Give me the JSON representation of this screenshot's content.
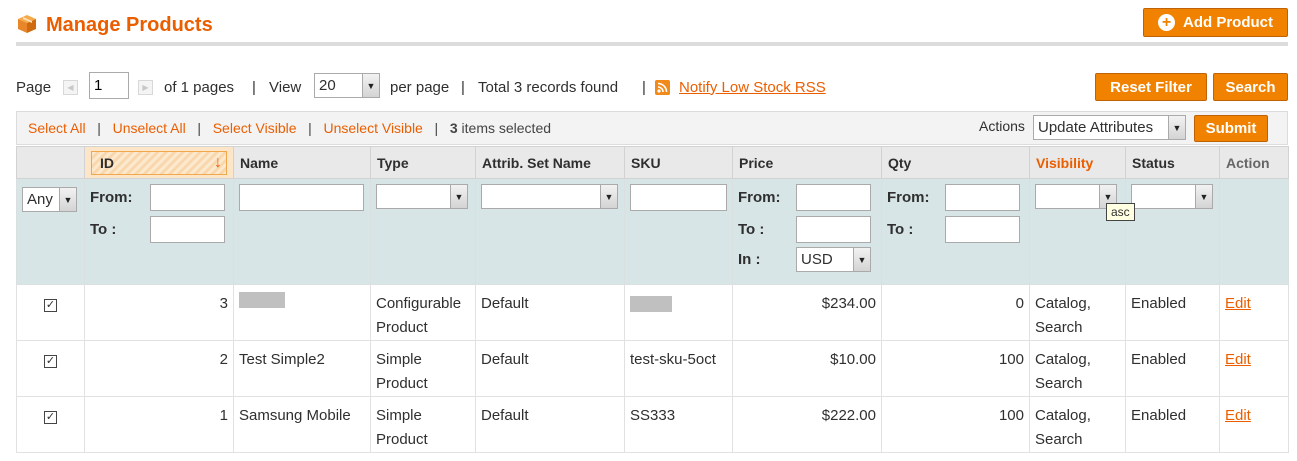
{
  "header": {
    "title": "Manage Products",
    "add_product_label": "Add Product",
    "box-icon": "box-icon"
  },
  "pager": {
    "page_label": "Page",
    "page_value": "1",
    "of_pages": "of 1 pages",
    "sep1": "|",
    "view_label": "View",
    "per_page_value": "20",
    "per_page_label": "per page",
    "sep2": "|",
    "total": "Total 3 records found",
    "sep3": "|",
    "rss_label": "Notify Low Stock RSS"
  },
  "filter_buttons": {
    "reset": "Reset Filter",
    "search": "Search"
  },
  "massaction": {
    "select_all": "Select All",
    "unselect_all": "Unselect All",
    "select_visible": "Select Visible",
    "unselect_visible": "Unselect Visible",
    "selected_count": "3",
    "selected_label": " items selected",
    "actions_label": "Actions",
    "action_value": "Update Attributes",
    "submit": "Submit"
  },
  "columns": {
    "id": "ID",
    "name": "Name",
    "type": "Type",
    "attr_set": "Attrib. Set Name",
    "sku": "SKU",
    "price": "Price",
    "qty": "Qty",
    "visibility": "Visibility",
    "status": "Status",
    "action": "Action"
  },
  "filters": {
    "any": "Any",
    "from": "From:",
    "to": "To :",
    "in": "In :",
    "currency": "USD"
  },
  "tooltip": "asc",
  "rows": [
    {
      "id": "3",
      "name": "",
      "type1": "Configurable",
      "type2": "Product",
      "attr_set": "Default",
      "sku": "",
      "price": "$234.00",
      "qty": "0",
      "vis1": "Catalog,",
      "vis2": "Search",
      "status": "Enabled",
      "action": "Edit"
    },
    {
      "id": "2",
      "name": "Test Simple2",
      "type1": "Simple",
      "type2": "Product",
      "attr_set": "Default",
      "sku": "test-sku-5oct",
      "price": "$10.00",
      "qty": "100",
      "vis1": "Catalog,",
      "vis2": "Search",
      "status": "Enabled",
      "action": "Edit"
    },
    {
      "id": "1",
      "name": "Samsung Mobile",
      "type1": "Simple",
      "type2": "Product",
      "attr_set": "Default",
      "sku": "SS333",
      "price": "$222.00",
      "qty": "100",
      "vis1": "Catalog,",
      "vis2": "Search",
      "status": "Enabled",
      "action": "Edit"
    }
  ]
}
